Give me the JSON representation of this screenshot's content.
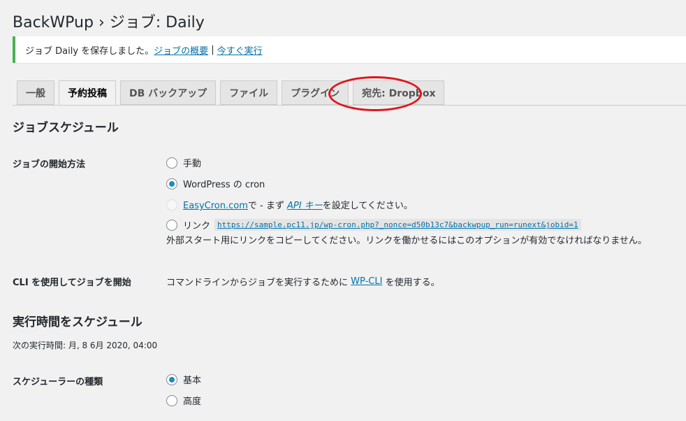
{
  "header": {
    "title": "BackWPup › ジョブ: Daily"
  },
  "notice": {
    "message": "ジョブ Daily を保存しました。",
    "link1": "ジョブの概要",
    "separator": "|",
    "link2": "今すぐ実行"
  },
  "tabs": [
    {
      "label": "一般",
      "active": false
    },
    {
      "label": "予約投稿",
      "active": true
    },
    {
      "label": "DB バックアップ",
      "active": false
    },
    {
      "label": "ファイル",
      "active": false
    },
    {
      "label": "プラグイン",
      "active": false
    },
    {
      "label": "宛先: Dropbox",
      "active": false
    }
  ],
  "colors": {
    "accent": "#0073aa",
    "success": "#46b450",
    "annotation": "#e2141b"
  },
  "schedule": {
    "heading": "ジョブスケジュール",
    "start_label": "ジョブの開始方法",
    "options": {
      "manual": "手動",
      "wpcron": "WordPress の cron",
      "easycron_link": "EasyCron.com",
      "easycron_mid": "で - まず",
      "easycron_api": "API キー",
      "easycron_end": "を設定してください。",
      "link_label": "リンク",
      "link_url": "https://sample.pc11.jp/wp-cron.php?_nonce=d50b13c7&backwpup_run=runext&jobid=1",
      "link_desc": "外部スタート用にリンクをコピーしてください。リンクを働かせるにはこのオプションが有効でなければなりません。"
    },
    "cli_label": "CLI を使用してジョブを開始",
    "cli_text_before": "コマンドラインからジョブを実行するために",
    "cli_link": "WP-CLI",
    "cli_text_after": "を使用する。"
  },
  "execution": {
    "heading": "実行時間をスケジュール",
    "next_run": "次の実行時間: 月, 8 6月 2020, 04:00",
    "type_label": "スケジューラーの種類",
    "type_basic": "基本",
    "type_advanced": "高度"
  }
}
